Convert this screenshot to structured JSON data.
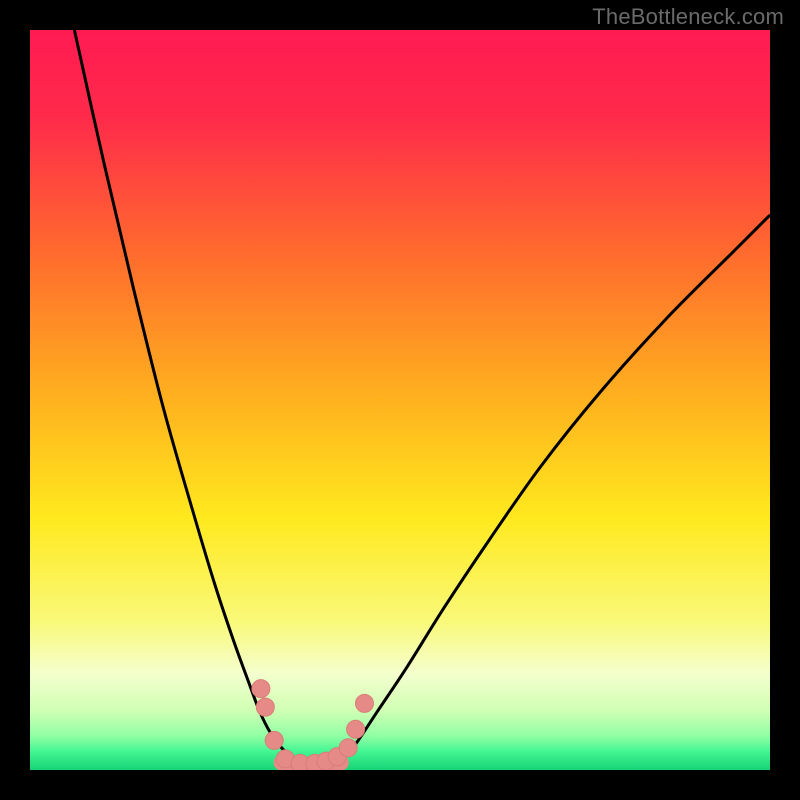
{
  "watermark": {
    "text": "TheBottleneck.com"
  },
  "colors": {
    "frame": "#000000",
    "gradient_stops": [
      {
        "offset": 0.0,
        "color": "#ff1a52"
      },
      {
        "offset": 0.12,
        "color": "#ff2b4a"
      },
      {
        "offset": 0.3,
        "color": "#ff6a2e"
      },
      {
        "offset": 0.5,
        "color": "#ffb21e"
      },
      {
        "offset": 0.66,
        "color": "#ffe91e"
      },
      {
        "offset": 0.8,
        "color": "#f9f97a"
      },
      {
        "offset": 0.87,
        "color": "#f4ffce"
      },
      {
        "offset": 0.92,
        "color": "#d0ffb4"
      },
      {
        "offset": 0.955,
        "color": "#8effa4"
      },
      {
        "offset": 0.975,
        "color": "#43f592"
      },
      {
        "offset": 1.0,
        "color": "#17d477"
      }
    ],
    "curve_stroke": "#000000",
    "marker_fill": "#e58a86",
    "marker_stroke": "#d97d78"
  },
  "chart_data": {
    "type": "line",
    "title": "",
    "xlabel": "",
    "ylabel": "",
    "xlim": [
      0,
      100
    ],
    "ylim": [
      0,
      100
    ],
    "grid": false,
    "legend": false,
    "note": "x is relative horizontal position (0=left edge of plot, 100=right). y is relative vertical position where 0=bottom green band and 100=top of plot. Values estimated from pixel positions; no axis ticks exist in the image.",
    "series": [
      {
        "name": "left-curve",
        "type": "line",
        "x": [
          6,
          10,
          14,
          18,
          22,
          25,
          27.5,
          29.5,
          31,
          32.5,
          34,
          36,
          38
        ],
        "y": [
          100,
          82,
          65,
          49,
          35,
          25,
          17.5,
          12,
          8,
          5,
          3,
          1.2,
          0.8
        ]
      },
      {
        "name": "floor-segment",
        "type": "line",
        "x": [
          34,
          36,
          38,
          40,
          42
        ],
        "y": [
          1.0,
          0.8,
          0.7,
          0.8,
          1.0
        ]
      },
      {
        "name": "right-curve",
        "type": "line",
        "x": [
          42,
          44,
          47,
          51,
          56,
          62,
          69,
          77,
          86,
          95,
          100
        ],
        "y": [
          1.2,
          3.5,
          8,
          14,
          22,
          31,
          41,
          51,
          61,
          70,
          75
        ]
      },
      {
        "name": "markers",
        "type": "scatter",
        "x": [
          31.2,
          31.8,
          33.0,
          34.5,
          36.5,
          38.5,
          40.0,
          41.5,
          43.0,
          44.0,
          45.2
        ],
        "y": [
          11.0,
          8.5,
          4.0,
          1.5,
          0.9,
          0.9,
          1.2,
          1.8,
          3.0,
          5.5,
          9.0
        ]
      }
    ]
  }
}
